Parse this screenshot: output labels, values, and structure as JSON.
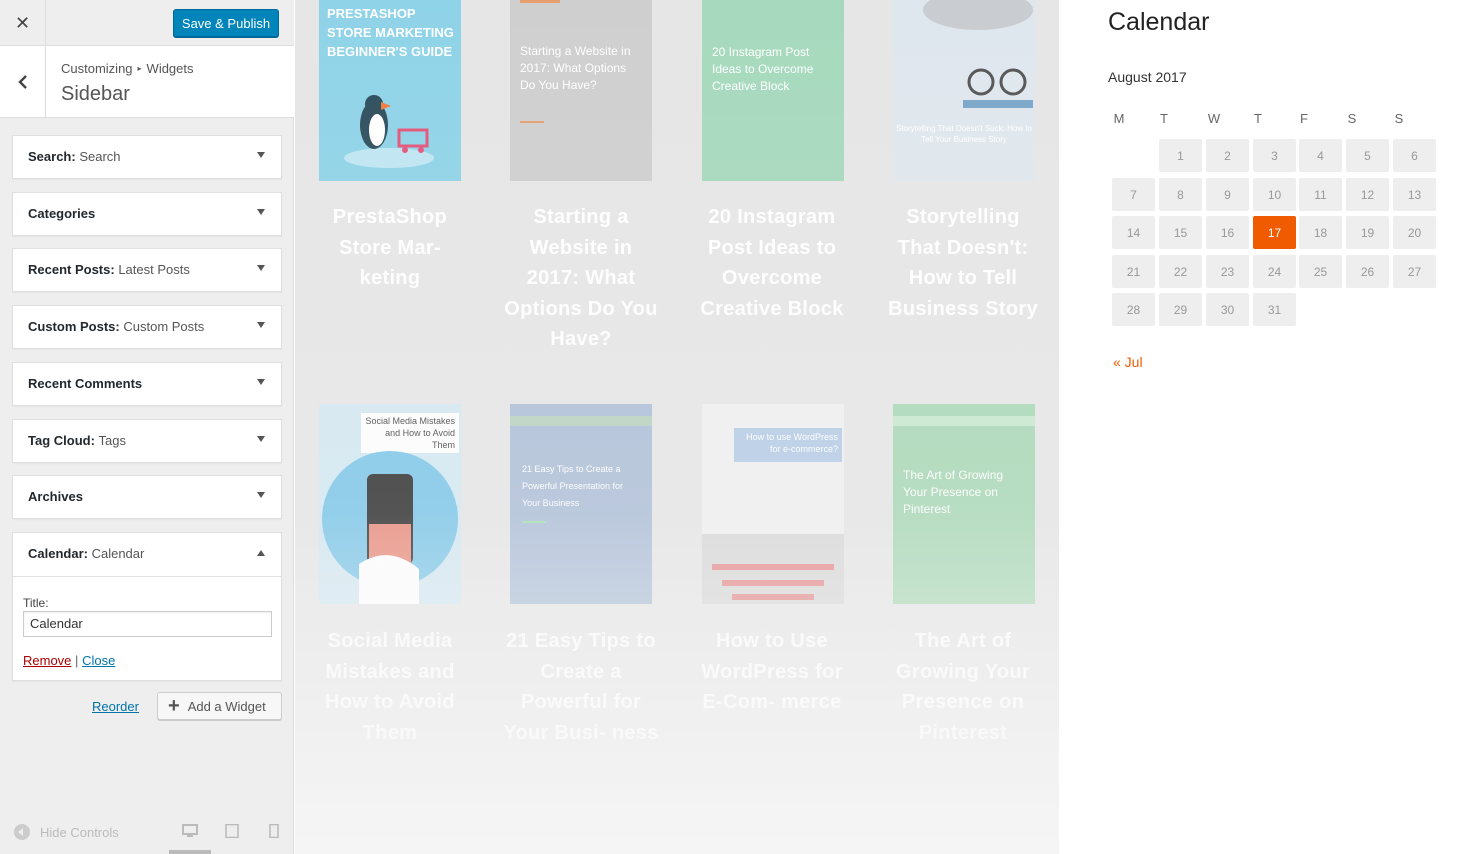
{
  "topbar": {
    "close_icon": "✕",
    "publish_label": "Save & Publish"
  },
  "section": {
    "crumb_root": "Customizing",
    "crumb_sep": "▸",
    "crumb_leaf": "Widgets",
    "title": "Sidebar"
  },
  "widgets": [
    {
      "name": "Search:",
      "sub": "Search"
    },
    {
      "name": "Categories",
      "sub": ""
    },
    {
      "name": "Recent Posts:",
      "sub": "Latest Posts"
    },
    {
      "name": "Custom Posts:",
      "sub": "Custom Posts"
    },
    {
      "name": "Recent Comments",
      "sub": ""
    },
    {
      "name": "Tag Cloud:",
      "sub": "Tags"
    },
    {
      "name": "Archives",
      "sub": ""
    },
    {
      "name": "Calendar:",
      "sub": "Calendar"
    }
  ],
  "calendar_widget_form": {
    "title_label": "Title:",
    "title_value": "Calendar",
    "remove_label": "Remove",
    "separator": "|",
    "close_label": "Close"
  },
  "reorder_label": "Reorder",
  "add_widget_label": "Add a Widget",
  "footer": {
    "hide_controls_label": "Hide Controls"
  },
  "posts": [
    {
      "title": "PrestaShop Store Mar- keting",
      "thumb_text": "PRESTASHOP STORE MARKETING BEGINNER'S GUIDE",
      "color": "#8fd3e8"
    },
    {
      "title": "Starting a Website in 2017: What Options Do You Have?",
      "thumb_text": "Starting a Website in 2017: What Options Do You Have?",
      "color": "#cfcfcf"
    },
    {
      "title": "20 Instagram Post Ideas to Overcome Creative Block",
      "thumb_text": "20 Instagram Post Ideas to Overcome Creative Block",
      "color": "#a6d9bd"
    },
    {
      "title": "Storytelling That Doesn't: How to Tell Business Story",
      "thumb_text": "Storytelling That Doesn't Suck: How to Tell Your Business Story",
      "color": "#dfe7ee"
    },
    {
      "title": "Social Media Mistakes and How to Avoid Them",
      "thumb_text": "Social Media Mistakes and How to Avoid Them",
      "color": "#d3e8f2"
    },
    {
      "title": "21 Easy Tips to Create a Powerful for Your Busi- ness",
      "thumb_text": "21 Easy Tips to Create a Powerful Presentation for Your Business",
      "color": "#aebfd8"
    },
    {
      "title": "How to Use WordPress for E-Com- merce",
      "thumb_text": "How to use WordPress for e-commerce?",
      "color": "#f0f0f0"
    },
    {
      "title": "The Art of Growing Your Presence on Pinterest",
      "thumb_text": "The Art of Growing Your Presence on Pinterest",
      "color": "#a9d8b6"
    }
  ],
  "calendar": {
    "heading": "Calendar",
    "caption": "August 2017",
    "weekdays": [
      "M",
      "T",
      "W",
      "T",
      "F",
      "S",
      "S"
    ],
    "days": [
      "1",
      "2",
      "3",
      "4",
      "5",
      "6",
      "7",
      "8",
      "9",
      "10",
      "11",
      "12",
      "13",
      "14",
      "15",
      "16",
      "17",
      "18",
      "19",
      "20",
      "21",
      "22",
      "23",
      "24",
      "25",
      "26",
      "27",
      "28",
      "29",
      "30",
      "31"
    ],
    "today": "17",
    "prev_label": "« Jul",
    "accent_color": "#f05a00"
  }
}
